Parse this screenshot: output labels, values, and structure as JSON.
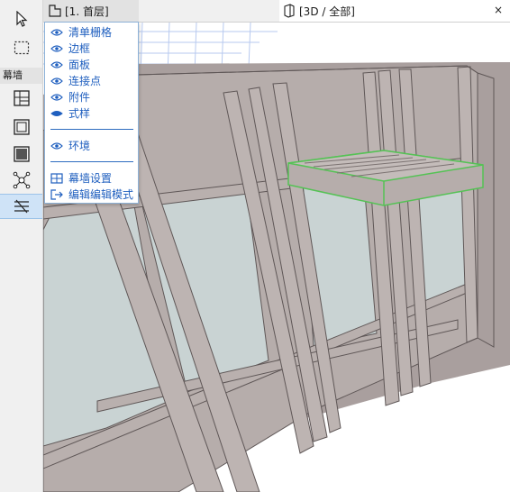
{
  "toolbox": {
    "section_label": "幕墙",
    "tools": [
      {
        "icon": "arrow-pointer-icon"
      },
      {
        "icon": "marquee-icon"
      },
      {
        "icon": "curtain-wall-grid-icon"
      },
      {
        "icon": "curtain-wall-frame-icon"
      },
      {
        "icon": "curtain-wall-panel-icon"
      },
      {
        "icon": "junction-icon"
      },
      {
        "icon": "accessory-icon"
      }
    ]
  },
  "tabs": {
    "plan_label": "[1. 首层]",
    "view3d_label": "[3D / 全部]",
    "close_glyph": "×"
  },
  "menu": {
    "items": [
      {
        "label": "清单栅格",
        "icon": "eye-icon"
      },
      {
        "label": "边框",
        "icon": "eye-icon"
      },
      {
        "label": "面板",
        "icon": "eye-icon"
      },
      {
        "label": "连接点",
        "icon": "eye-icon"
      },
      {
        "label": "附件",
        "icon": "eye-icon"
      },
      {
        "label": "式样",
        "icon": "eye-closed-icon"
      },
      {
        "label": "环境",
        "icon": "eye-icon"
      },
      {
        "label": "幕墙设置",
        "icon": "settings-grid-icon"
      },
      {
        "label": "编辑编辑模式",
        "icon": "exit-edit-icon"
      }
    ]
  },
  "colors": {
    "accent": "#1f5fbf",
    "frame": "#b6adab",
    "frame_dark": "#8f8584",
    "glass": "#c9d3d3",
    "selection": "#55c255",
    "active_tool": "#cfe3f7"
  }
}
